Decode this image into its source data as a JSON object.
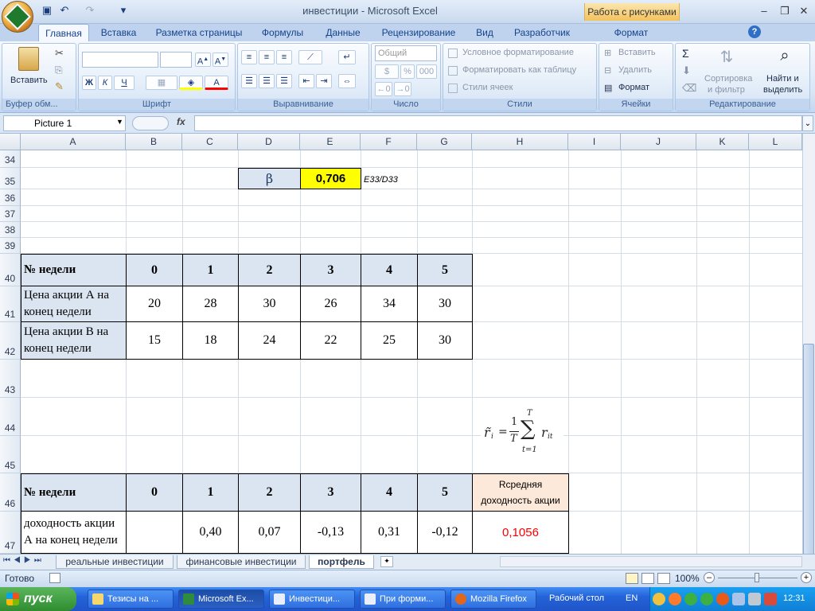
{
  "window": {
    "title": "инвестиции - Microsoft Excel",
    "context_tab_title": "Работа с рисунками"
  },
  "ribbon_tabs": [
    {
      "label": "Главная",
      "active": true
    },
    {
      "label": "Вставка"
    },
    {
      "label": "Разметка страницы"
    },
    {
      "label": "Формулы"
    },
    {
      "label": "Данные"
    },
    {
      "label": "Рецензирование"
    },
    {
      "label": "Вид"
    },
    {
      "label": "Разработчик"
    },
    {
      "label": "Формат"
    }
  ],
  "ribbon": {
    "clipboard": {
      "label": "Буфер обм...",
      "paste": "Вставить"
    },
    "font": {
      "label": "Шрифт",
      "bold": "Ж",
      "italic": "К",
      "underline": "Ч"
    },
    "alignment": {
      "label": "Выравнивание"
    },
    "number": {
      "label": "Число",
      "format": "Общий",
      "percent": "%",
      "thousands": "000"
    },
    "styles": {
      "label": "Стили",
      "conditional": "Условное форматирование",
      "as_table": "Форматировать как таблицу",
      "cell_styles": "Стили ячеек"
    },
    "cells": {
      "label": "Ячейки",
      "insert": "Вставить",
      "delete": "Удалить",
      "format": "Формат"
    },
    "editing": {
      "label": "Редактирование",
      "sort_l1": "Сортировка",
      "sort_l2": "и фильтр",
      "find_l1": "Найти и",
      "find_l2": "выделить"
    }
  },
  "formula_bar": {
    "name_box": "Picture 1",
    "fx": "fx",
    "formula": ""
  },
  "columns": [
    "A",
    "B",
    "C",
    "D",
    "E",
    "F",
    "G",
    "H",
    "I",
    "J",
    "K",
    "L"
  ],
  "rows": [
    "34",
    "35",
    "36",
    "37",
    "38",
    "39",
    "40",
    "41",
    "42",
    "43",
    "44",
    "45",
    "46",
    "47"
  ],
  "cells": {
    "beta_symbol": "β",
    "beta_value": "0,706",
    "beta_formula": "E33/D33",
    "table1": {
      "header": [
        "№ недели",
        "0",
        "1",
        "2",
        "3",
        "4",
        "5"
      ],
      "rowA_label": "Цена акции А на конец недели",
      "rowA": [
        "20",
        "28",
        "30",
        "26",
        "34",
        "30"
      ],
      "rowB_label": "Цена акции В на конец недели",
      "rowB": [
        "15",
        "18",
        "24",
        "22",
        "25",
        "30"
      ]
    },
    "formula_image": {
      "lhs": "r̃",
      "sub": "i",
      "eq": "=",
      "num": "1",
      "den": "T",
      "sigma": "∑",
      "top": "T",
      "bottom": "t=1",
      "term": "r",
      "term_sub": "it"
    },
    "table2": {
      "header": [
        "№ недели",
        "0",
        "1",
        "2",
        "3",
        "4",
        "5"
      ],
      "avg_header": "Rсредняя доходность акции",
      "rowA_label": "доходность акции А на конец недели",
      "rowA": [
        "",
        "0,40",
        "0,07",
        "-0,13",
        "0,31",
        "-0,12"
      ],
      "rowA_avg": "0,1056"
    }
  },
  "sheets": [
    {
      "label": "реальные инвестиции"
    },
    {
      "label": "финансовые инвестиции"
    },
    {
      "label": "портфель",
      "active": true
    }
  ],
  "status": {
    "ready": "Готово",
    "zoom": "100%"
  },
  "taskbar": {
    "start": "пуск",
    "tasks": [
      "Тезисы на ...",
      "Microsoft Ex...",
      "Инвестици...",
      "При форми...",
      "Mozilla Firefox"
    ],
    "desktop": "Рабочий стол",
    "lang": "EN",
    "clock": "12:31"
  },
  "colors": {
    "beta_highlight": "#ffff00",
    "header_fill": "#dbe5f1",
    "avg_header_fill": "#fde9d9",
    "avg_value": "#ff0000"
  }
}
